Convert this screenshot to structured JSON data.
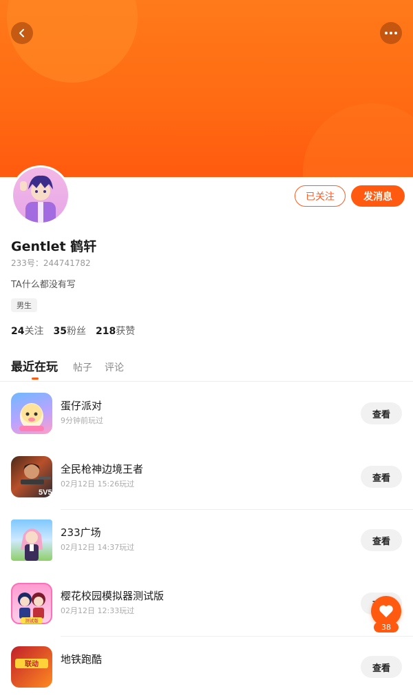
{
  "header": {
    "back_icon": "back-arrow-icon",
    "more_icon": "more-dots-icon",
    "banner_color": "#ff6a12"
  },
  "profile": {
    "name": "Gentlet 鹤轩",
    "uid": "233号：244741782",
    "bio": "TA什么都没有写",
    "gender_tag": "男生",
    "followed_label": "已关注",
    "message_label": "发消息"
  },
  "stats": {
    "following_count": "24",
    "following_label": "关注",
    "fans_count": "35",
    "fans_label": "粉丝",
    "likes_count": "218",
    "likes_label": "获赞"
  },
  "tabs": [
    {
      "label": "最近在玩",
      "active": true
    },
    {
      "label": "帖子",
      "active": false
    },
    {
      "label": "评论",
      "active": false
    }
  ],
  "games": [
    {
      "title": "蛋仔派对",
      "subtitle": "9分钟前玩过",
      "button": "查看"
    },
    {
      "title": "全民枪神边境王者",
      "subtitle": "02月12日 15:26玩过",
      "button": "查看",
      "icon_text": "5V5"
    },
    {
      "title": "233广场",
      "subtitle": "02月12日 14:37玩过",
      "button": "查看"
    },
    {
      "title": "樱花校园模拟器测试版",
      "subtitle": "02月12日 12:33玩过",
      "button": "查看",
      "icon_text": "测试版"
    },
    {
      "title": "地铁跑酷",
      "subtitle": "",
      "button": "查看",
      "icon_text": "联动"
    }
  ],
  "fab": {
    "icon": "heart-icon",
    "count": "38"
  },
  "colors": {
    "accent": "#ff5a10",
    "text_primary": "#1a1a1a",
    "text_secondary": "#999999"
  }
}
